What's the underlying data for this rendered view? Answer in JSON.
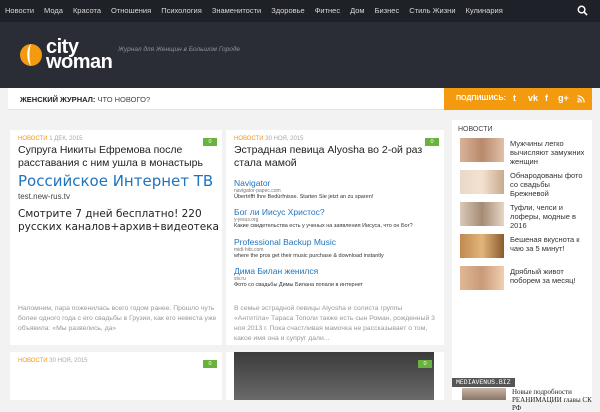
{
  "nav": {
    "items": [
      "Новости",
      "Мода",
      "Красота",
      "Отношения",
      "Психология",
      "Знаменитости",
      "Здоровье",
      "Фитнес",
      "Дом",
      "Бизнес",
      "Стиль Жизни",
      "Кулинария"
    ],
    "search_icon": "search-icon"
  },
  "logo": {
    "line1": "city",
    "line2": "woman",
    "tagline": "Журнал для Женщин в Большом Городе"
  },
  "breadcrumb": {
    "section": "Женский журнал:",
    "page": "Что нового?"
  },
  "subscribe": {
    "label": "ПОДПИШИСЬ:",
    "icons": [
      "twitter-icon",
      "vk-icon",
      "facebook-icon",
      "google-plus-icon",
      "rss-icon"
    ]
  },
  "cards": [
    {
      "category": "Новости",
      "date": "1 Дек, 2015",
      "comments": "0",
      "title": "Супруга Никиты Ефремова после расставания с ним ушла в монастырь",
      "ad": {
        "title": "Российское Интернет ТВ",
        "url": "test.new-rus.tv",
        "desc": "Смотрите 7 дней бесплатно! 220 русских каналов+архив+видеотека"
      },
      "excerpt": "Напомним, пара поженилась всего годом ранее. Прошло чуть более одного года с его свадьбы в Грузии, как его невеста уже объявила: «Мы развелись, да»"
    },
    {
      "category": "Новости",
      "date": "30 Ноя, 2015",
      "comments": "0",
      "title": "Эстрадная певица Alyosha во 2-ой раз стала мамой",
      "ads": [
        {
          "title": "Navigator",
          "url": "navigator-papec.com",
          "desc": "Übertrifft Ihre Bedürfnisse. Starten Sie jetzt an zu sparen!"
        },
        {
          "title": "Бог ли Иисус Христос?",
          "url": "y-jesus.org",
          "desc": "Какие свидетельства есть у ученых на заявления Иисуса, что он Бог?"
        },
        {
          "title": "Professional Backup Music",
          "url": "midi-hits.com",
          "desc": "where the pros get their music purchase & download instantly"
        },
        {
          "title": "Дима Билан женился",
          "url": "stv.ru",
          "desc": "Фото со свадьбы Димы Билана попали в интернет"
        }
      ],
      "excerpt": "В семье эстрадной певицы Alyosha и солиста группы «Антитіла» Тараса Тополи также есть сын Роман, рожденный 3 ноя 2013 г. Пока счастливая мамочка не рассказывает о том, какое имя она и супруг дали..."
    },
    {
      "category": "Новости",
      "date": "30 Ноя, 2015",
      "comments": "0"
    },
    {
      "comments": "0"
    }
  ],
  "sidebar": {
    "heading": "Новости",
    "items": [
      {
        "text": "Мужчины легко вычисляют замужних женщин"
      },
      {
        "text": "Обнародованы фото со свадьбы Брежневой"
      },
      {
        "text": "Туфли, челси и лоферы, модные в 2016"
      },
      {
        "text": "Бешеная вкуснота к чаю за 5 минут!"
      },
      {
        "text": "Дряблый живот поборем за месяц!"
      }
    ]
  },
  "mediavenus": {
    "brand": "MEDIAVENUS.BIZ",
    "text": "Новые подробности РЕАНИМАЦИИ главы СК РФ"
  }
}
